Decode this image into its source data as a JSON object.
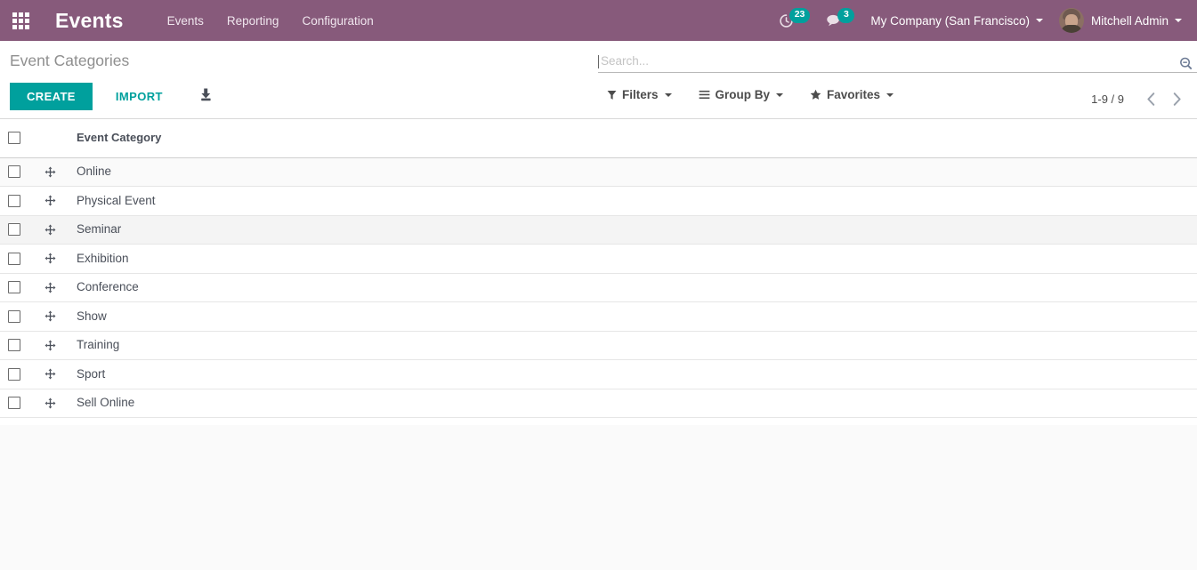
{
  "navbar": {
    "apps_icon": "apps-grid-icon",
    "brand": "Events",
    "menu": [
      {
        "label": "Events",
        "name": "nav-item-events"
      },
      {
        "label": "Reporting",
        "name": "nav-item-reporting"
      },
      {
        "label": "Configuration",
        "name": "nav-item-configuration"
      }
    ],
    "activities": {
      "icon": "clock-icon",
      "count": "23"
    },
    "messages": {
      "icon": "chat-bubble-icon",
      "count": "3"
    },
    "company": "My Company (San Francisco)",
    "user": "Mitchell Admin",
    "colors": {
      "bar": "#875A7B",
      "badge": "#00A09D"
    }
  },
  "control_panel": {
    "title": "Event Categories",
    "create_label": "CREATE",
    "import_label": "IMPORT",
    "export_icon": "download-export-icon",
    "accent_color": "#00A09D"
  },
  "search": {
    "placeholder": "Search...",
    "value": "",
    "magnifier_icon": "search-icon"
  },
  "filters": [
    {
      "label": "Filters",
      "icon": "funnel-icon",
      "name": "filters-dropdown"
    },
    {
      "label": "Group By",
      "icon": "list-lines-icon",
      "name": "group-by-dropdown"
    },
    {
      "label": "Favorites",
      "icon": "star-icon",
      "name": "favorites-dropdown"
    }
  ],
  "pager": {
    "range": "1-9 / 9",
    "prev_icon": "chevron-left-icon",
    "next_icon": "chevron-right-icon"
  },
  "table": {
    "columns": [
      "Event Category"
    ],
    "rows": [
      {
        "name": "Online"
      },
      {
        "name": "Physical Event"
      },
      {
        "name": "Seminar"
      },
      {
        "name": "Exhibition"
      },
      {
        "name": "Conference"
      },
      {
        "name": "Show"
      },
      {
        "name": "Training"
      },
      {
        "name": "Sport"
      },
      {
        "name": "Sell Online"
      }
    ]
  }
}
